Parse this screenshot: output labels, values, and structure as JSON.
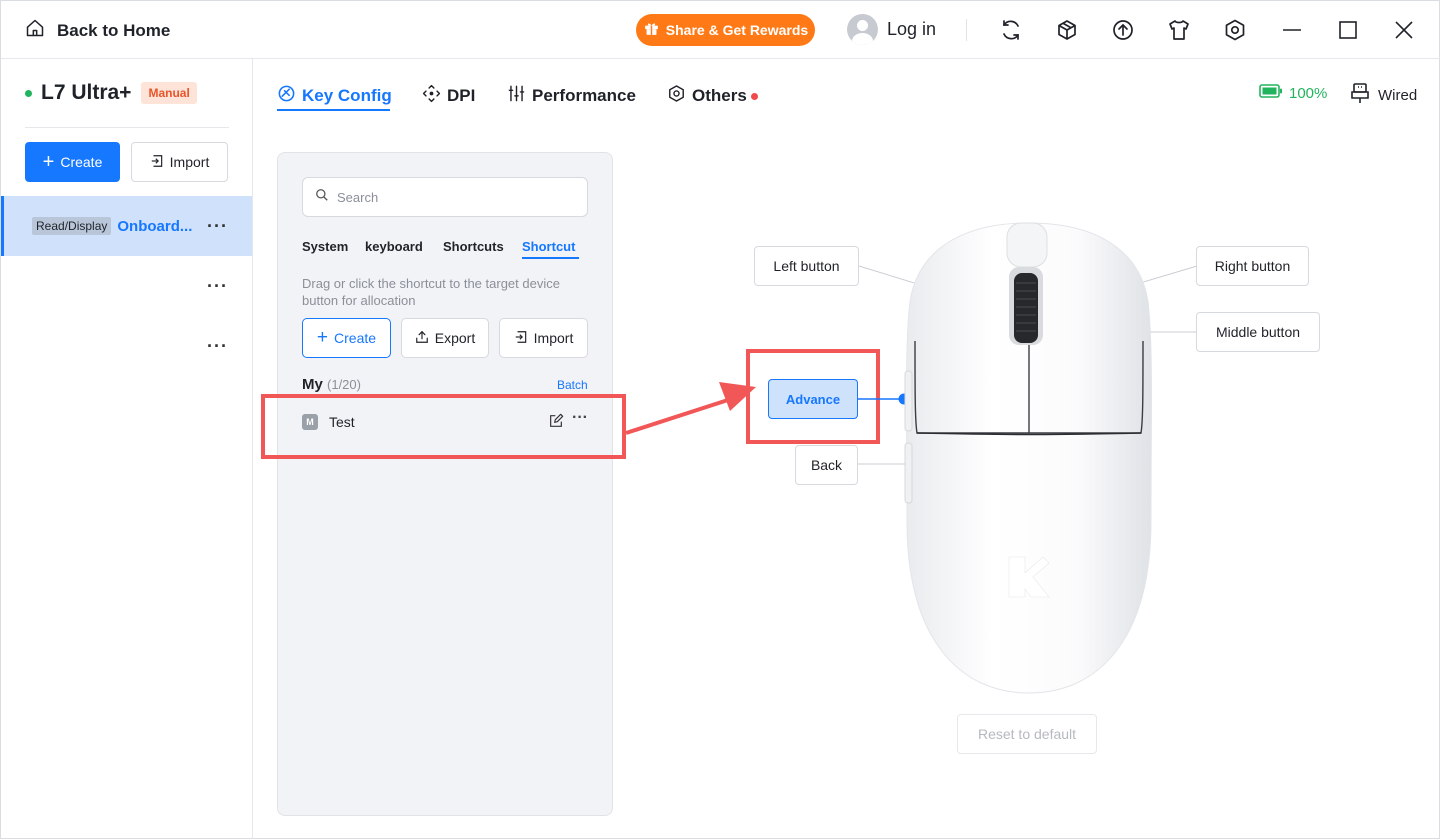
{
  "titlebar": {
    "back_label": "Back to Home",
    "share_label": "Share & Get Rewards",
    "login_label": "Log in"
  },
  "sidebar": {
    "device_name": "L7 Ultra+",
    "mode_badge": "Manual",
    "create_label": "Create",
    "import_label": "Import",
    "profiles": [
      {
        "badge": "Read/Display",
        "name": "Onboard...",
        "more": "···"
      },
      {
        "more": "···"
      },
      {
        "more": "···"
      }
    ]
  },
  "tabs": [
    {
      "label": "Key Config"
    },
    {
      "label": "DPI"
    },
    {
      "label": "Performance"
    },
    {
      "label": "Others"
    }
  ],
  "status": {
    "battery": "100%",
    "connection": "Wired"
  },
  "panel": {
    "search_placeholder": "Search",
    "subtabs": [
      "System",
      "keyboard",
      "Shortcuts",
      "Shortcut"
    ],
    "hint": "Drag or click the shortcut to the target device button for allocation",
    "create_label": "Create",
    "export_label": "Export",
    "import_label": "Import",
    "my_label": "My",
    "my_count": "(1/20)",
    "batch_label": "Batch",
    "items": [
      {
        "badge": "M",
        "name": "Test",
        "more": "···"
      }
    ]
  },
  "mouse": {
    "left_button": "Left button",
    "right_button": "Right button",
    "middle_button": "Middle button",
    "advance": "Advance",
    "back": "Back",
    "reset": "Reset to default"
  },
  "colors": {
    "accent": "#1677ff",
    "share": "#ff7a16",
    "annotation": "#f25757",
    "battery": "#22b35e"
  }
}
